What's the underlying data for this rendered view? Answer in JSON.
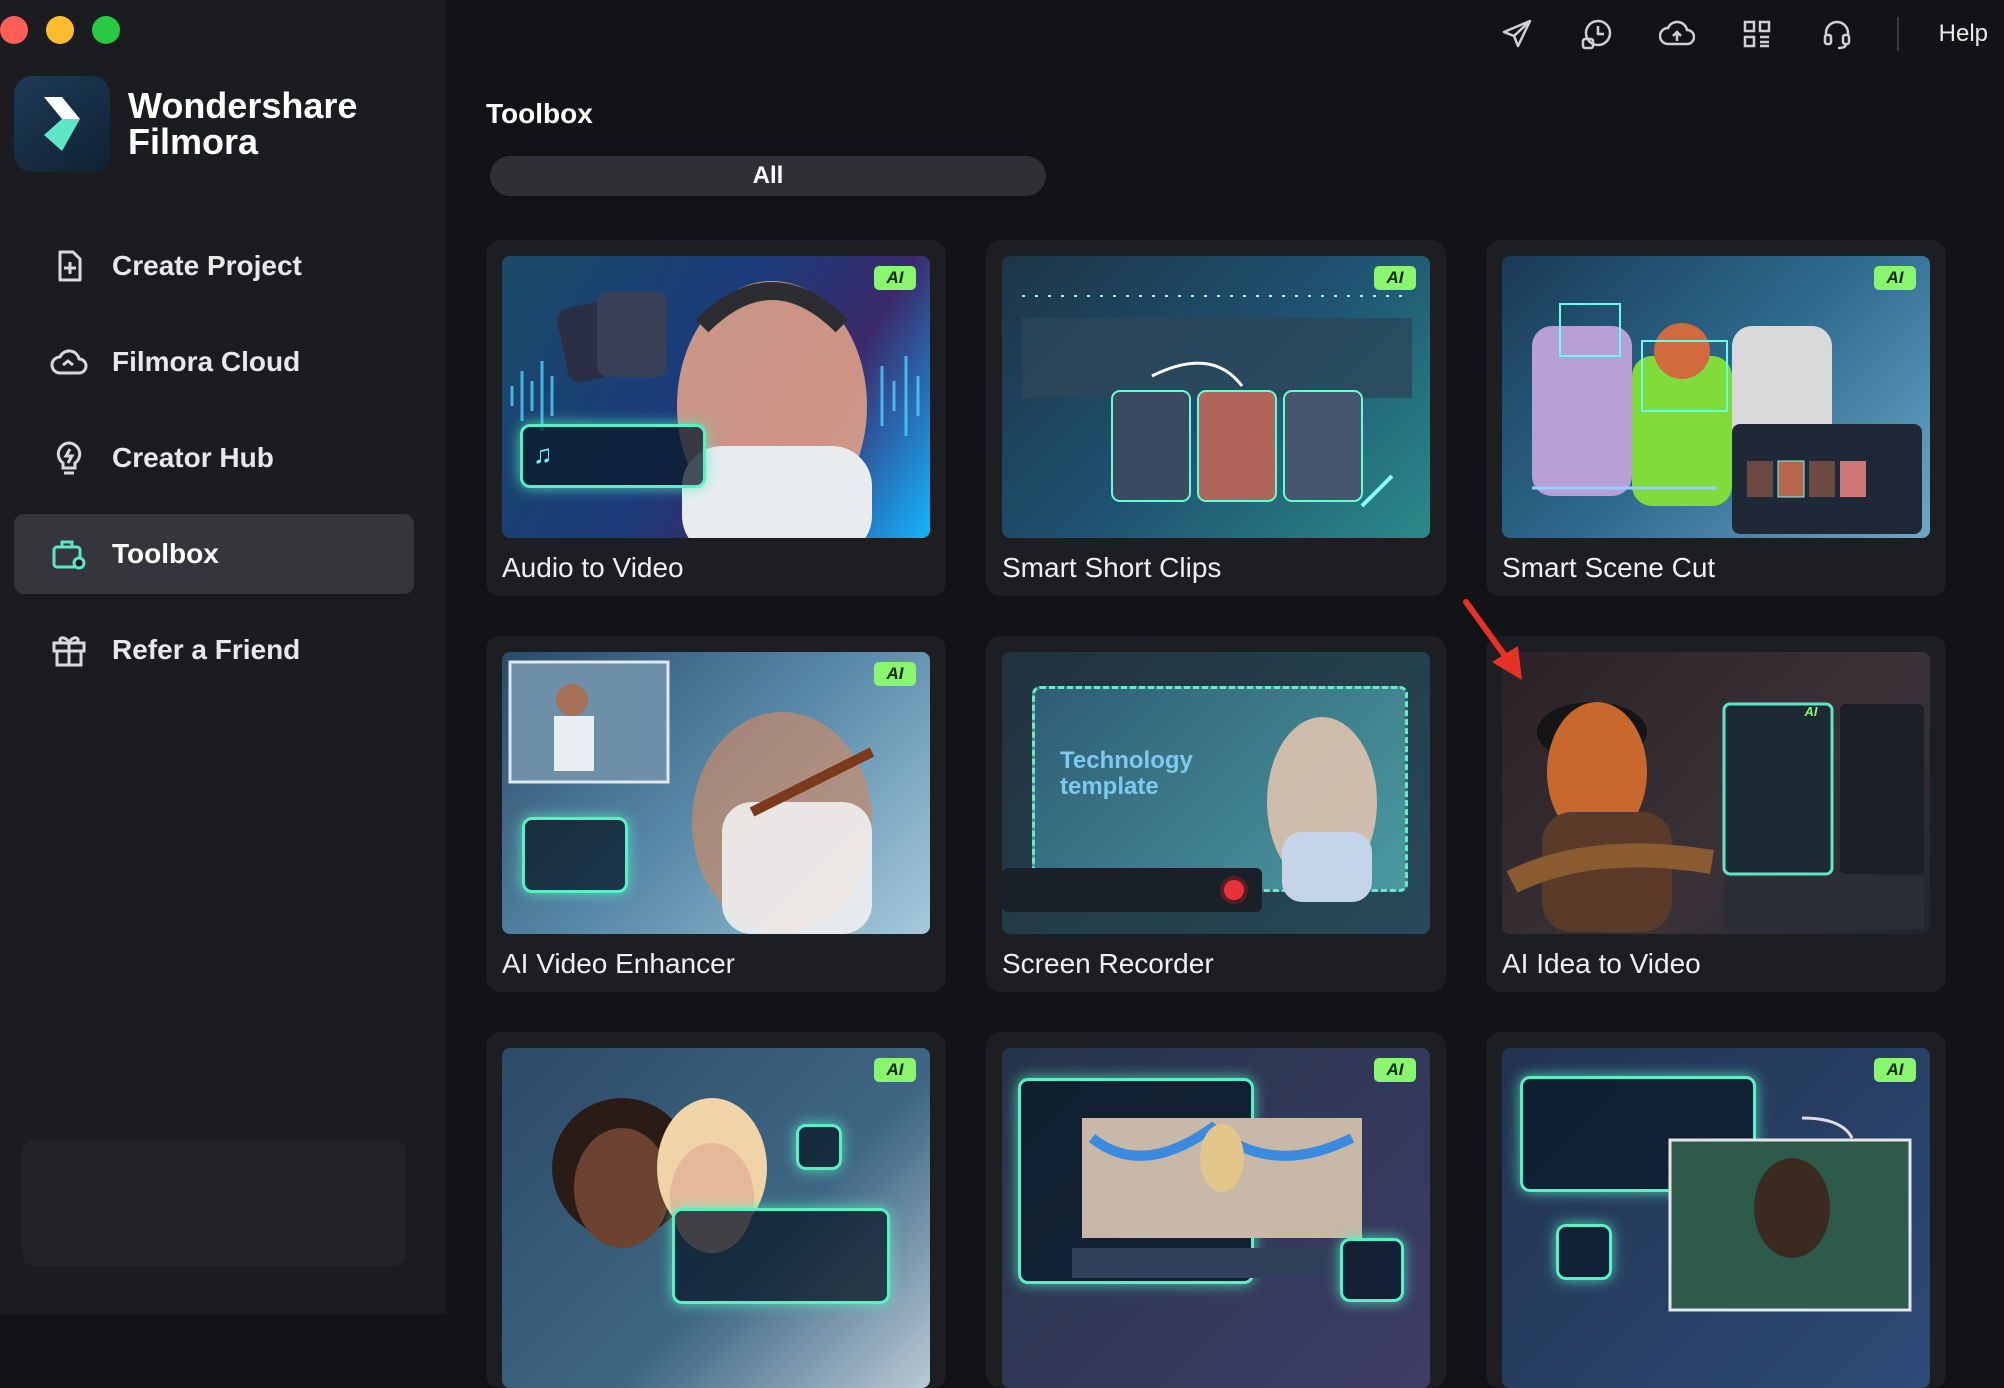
{
  "app": {
    "brand_line1": "Wondershare",
    "brand_line2": "Filmora"
  },
  "sidebar": {
    "items": [
      {
        "label": "Create Project",
        "icon": "create-project-icon",
        "active": false
      },
      {
        "label": "Filmora Cloud",
        "icon": "cloud-icon",
        "active": false
      },
      {
        "label": "Creator Hub",
        "icon": "lightbulb-icon",
        "active": false
      },
      {
        "label": "Toolbox",
        "icon": "toolbox-icon",
        "active": true
      },
      {
        "label": "Refer a Friend",
        "icon": "gift-icon",
        "active": false
      }
    ]
  },
  "topbar": {
    "icons": [
      "send-icon",
      "history-icon",
      "cloud-upload-icon",
      "apps-grid-icon",
      "headset-icon"
    ],
    "help_label": "Help"
  },
  "main": {
    "title": "Toolbox",
    "filter_label": "All",
    "ai_badge": "AI",
    "tools": [
      {
        "label": "Audio to Video",
        "ai": true
      },
      {
        "label": "Smart Short Clips",
        "ai": true
      },
      {
        "label": "Smart Scene Cut",
        "ai": true
      },
      {
        "label": "AI Video Enhancer",
        "ai": true
      },
      {
        "label": "Screen Recorder",
        "ai": false
      },
      {
        "label": "AI Idea to Video",
        "ai": false
      },
      {
        "label": "",
        "ai": true
      },
      {
        "label": "",
        "ai": true
      },
      {
        "label": "",
        "ai": true
      }
    ],
    "thumb_texts": {
      "tech_line1": "Technology",
      "tech_line2": "template"
    }
  },
  "colors": {
    "accent_green": "#8af56f",
    "glow": "#59f0c4",
    "annotation_arrow": "#e53224"
  }
}
